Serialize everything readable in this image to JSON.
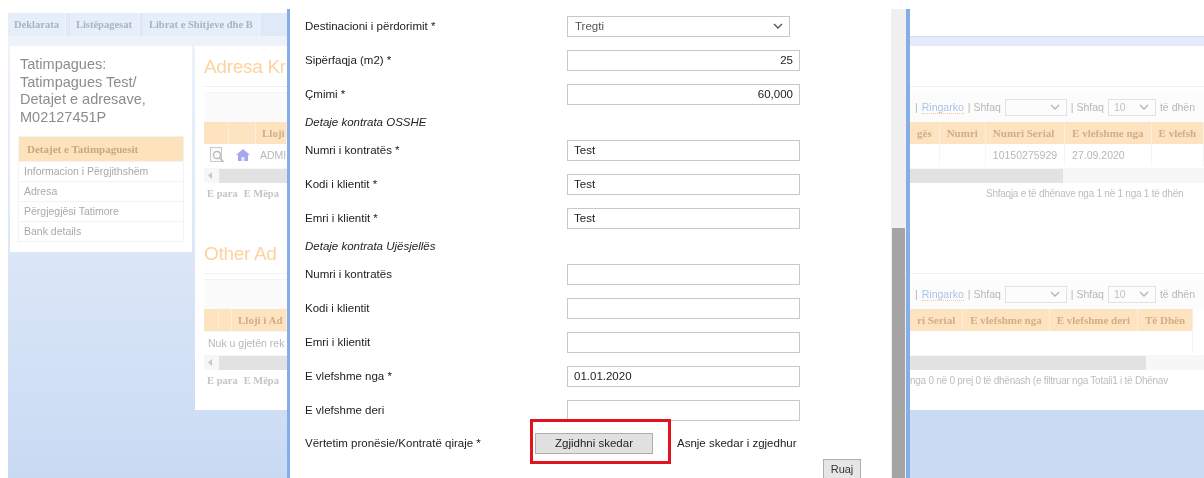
{
  "background": {
    "tabs": [
      {
        "label": "Deklarata",
        "selected": false
      },
      {
        "label": "Listëpagesat",
        "selected": false
      },
      {
        "label": "Librat e Shitjeve dhe B",
        "selected": false
      }
    ],
    "taxpayer_title": "Tatimpagues: Tatimpagues Test/ Detajet e adresave, M02127451P",
    "menu": {
      "header": "Detajet e Tatimpaguesit",
      "items": [
        "Informacion i Përgjithshëm",
        "Adresa",
        "Përgjegjësi Tatimore",
        "Bank details"
      ]
    },
    "left_sections": [
      {
        "title": "Adresa Kr",
        "columns": [
          "Lloji"
        ],
        "row": {
          "kind": "record",
          "cells": [
            "ADMI"
          ]
        },
        "footer": [
          "E para",
          "E Mëpa"
        ]
      },
      {
        "title": "Other Ad",
        "columns": [
          "Lloji i Ad"
        ],
        "row": {
          "kind": "empty",
          "message": "Nuk u gjetën rek"
        },
        "footer": [
          "E para",
          "E Mëpa"
        ]
      }
    ],
    "right_sections": [
      {
        "toolbar": [
          {
            "kind": "text",
            "text": "|"
          },
          {
            "kind": "link",
            "text": "Ringarko"
          },
          {
            "kind": "text",
            "text": "| Shfaq"
          },
          {
            "kind": "select"
          },
          {
            "kind": "text",
            "text": "| Shfaq"
          },
          {
            "kind": "select",
            "value": "10"
          },
          {
            "kind": "text",
            "text": "të dhën"
          }
        ],
        "columns": [
          "gës",
          "Numri",
          "Numri Serial",
          "E vlefshme nga",
          "E vlefsh"
        ],
        "row": {
          "kind": "record",
          "cells": [
            null,
            null,
            "10150275929",
            "27.09.2020",
            null
          ]
        },
        "info": "Shfaqja e të dhënave nga 1 në 1 nga 1 të dhën"
      },
      {
        "toolbar": [
          {
            "kind": "text",
            "text": "|"
          },
          {
            "kind": "link",
            "text": "Ringarko"
          },
          {
            "kind": "text",
            "text": "| Shfaq"
          },
          {
            "kind": "select"
          },
          {
            "kind": "text",
            "text": "| Shfaq"
          },
          {
            "kind": "select",
            "value": "10"
          },
          {
            "kind": "text",
            "text": "të dhën"
          }
        ],
        "columns": [
          "ri Serial",
          "E vlefshme nga",
          "E vlefshme deri",
          "Të Dhën"
        ],
        "row": {
          "kind": "empty"
        },
        "info": "nga 0 në 0 prej 0 të dhënash (e filtruar nga Totali1 i të Dhënav"
      }
    ]
  },
  "modal": {
    "rows": [
      {
        "kind": "select",
        "label": "Destinacioni i përdorimit *",
        "value": "Tregti"
      },
      {
        "kind": "number",
        "label": "Sipërfaqja (m2) *",
        "value": "25"
      },
      {
        "kind": "number",
        "label": "Çmimi *",
        "value": "60,000"
      },
      {
        "kind": "section",
        "label": "Detaje kontrata OSSHE"
      },
      {
        "kind": "text",
        "label": "Numri i kontratës *",
        "value": "Test"
      },
      {
        "kind": "text",
        "label": "Kodi i klientit *",
        "value": "Test"
      },
      {
        "kind": "text",
        "label": "Emri i klientit *",
        "value": "Test"
      },
      {
        "kind": "section",
        "label": "Detaje kontrata Ujësjellës"
      },
      {
        "kind": "text",
        "label": "Numri i kontratës"
      },
      {
        "kind": "text",
        "label": "Kodi i klientit"
      },
      {
        "kind": "text",
        "label": "Emri i klientit"
      },
      {
        "kind": "text",
        "label": "E vlefshme nga *",
        "value": "01.01.2020"
      },
      {
        "kind": "text",
        "label": "E vlefshme deri"
      },
      {
        "kind": "file",
        "label": "Vërtetim pronësie/Kontratë qiraje *",
        "button": "Zgjidhni skedar",
        "status": "Asnje skedar i zgjedhur",
        "highlighted": true
      }
    ],
    "save_button": "Ruaj"
  }
}
